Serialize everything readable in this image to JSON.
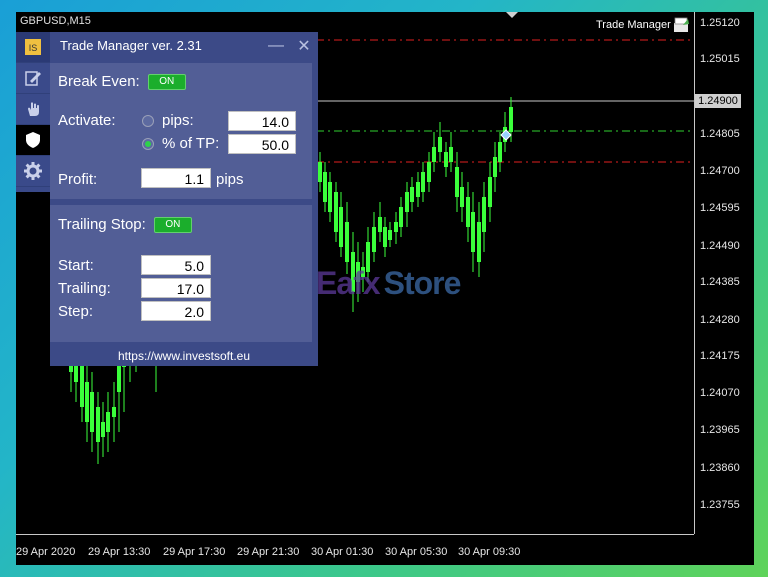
{
  "chart": {
    "symbol": "GBPUSD,M15",
    "indicator_label": "Trade Manager",
    "current_price": "1.24900",
    "price_axis": [
      "1.25120",
      "1.25015",
      "1.24805",
      "1.24700",
      "1.24595",
      "1.24490",
      "1.24385",
      "1.24280",
      "1.24175",
      "1.24070",
      "1.23965",
      "1.23860",
      "1.23755"
    ],
    "time_axis": [
      "29 Apr 2020",
      "29 Apr 13:30",
      "29 Apr 17:30",
      "29 Apr 21:30",
      "30 Apr 01:30",
      "30 Apr 05:30",
      "30 Apr 09:30"
    ],
    "colors": {
      "candle": "#3bff3b",
      "stop_line": "#e02020",
      "tp_line": "#2fcf2f",
      "price_line": "#c8c8c8"
    }
  },
  "watermark": {
    "part1": "Eafx",
    "part2": "Store"
  },
  "sidebar": {
    "items": [
      {
        "icon": "logo-icon"
      },
      {
        "icon": "edit-icon"
      },
      {
        "icon": "hand-icon"
      },
      {
        "icon": "shield-icon"
      },
      {
        "icon": "gear-icon"
      }
    ]
  },
  "panel": {
    "title": "Trade Manager ver. 2.31",
    "minimize": "—",
    "close": "✕",
    "break_even": {
      "label": "Break Even:",
      "toggle": "ON",
      "activate_label": "Activate:",
      "option_pips": "pips:",
      "pips_value": "14.0",
      "option_tp": "% of TP:",
      "tp_value": "50.0",
      "profit_label": "Profit:",
      "profit_value": "1.1",
      "profit_unit": "pips"
    },
    "trailing_stop": {
      "label": "Trailing Stop:",
      "toggle": "ON",
      "start_label": "Start:",
      "start_value": "5.0",
      "trailing_label": "Trailing:",
      "trailing_value": "17.0",
      "step_label": "Step:",
      "step_value": "2.0"
    },
    "footer_link": "https://www.investsoft.eu"
  }
}
